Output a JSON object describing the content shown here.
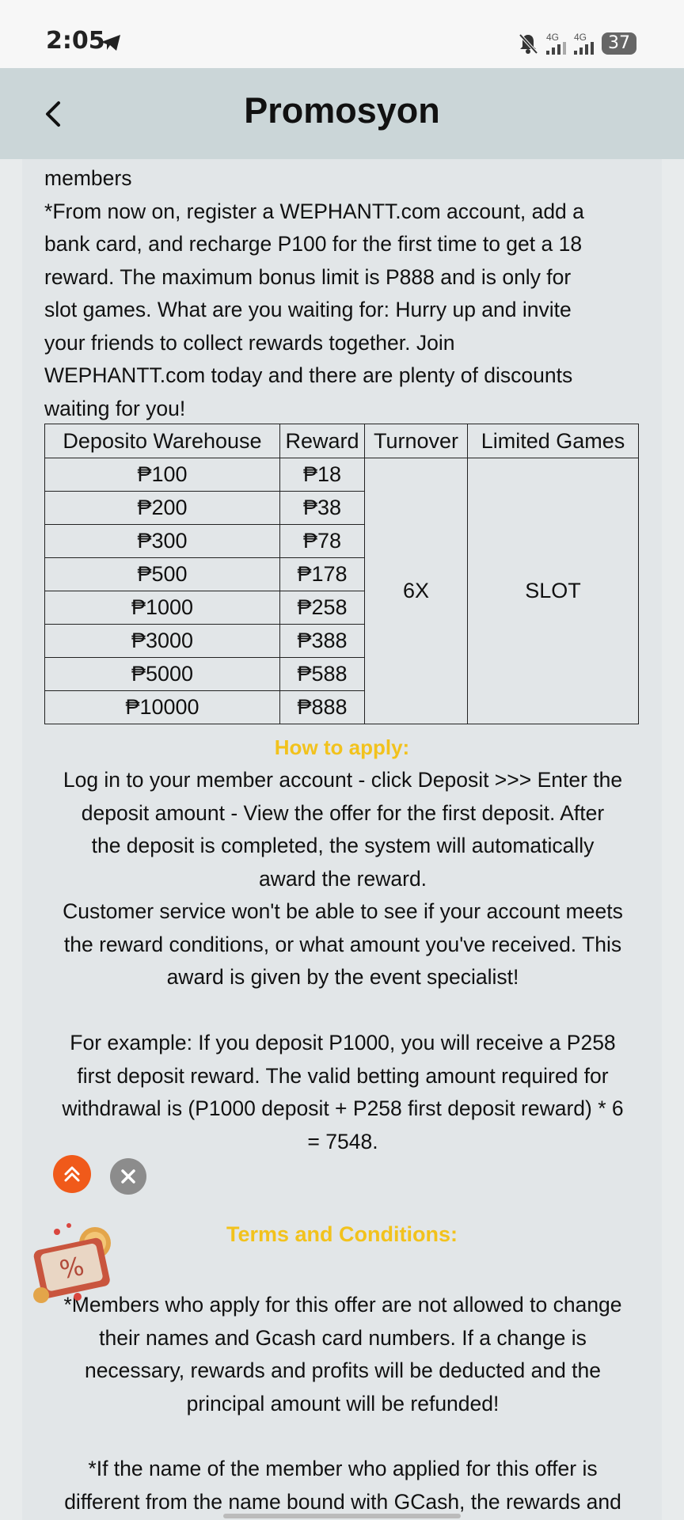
{
  "status": {
    "time": "2:05",
    "network1": "4G",
    "network2": "4G",
    "battery": "37"
  },
  "header": {
    "title": "Promosyon"
  },
  "content": {
    "intro": [
      "members",
      "*From now on, register a WEPHANTT.com account, add a",
      "bank card, and recharge P100 for the first time to get a 18",
      "reward. The maximum bonus limit is P888 and is only for",
      "slot games. What are you waiting for: Hurry up and invite",
      "your friends to collect rewards together. Join",
      "WEPHANTT.com today and there are plenty of discounts",
      "waiting for you!"
    ],
    "table": {
      "headers": [
        "Deposito Warehouse",
        "Reward",
        "Turnover",
        "Limited Games"
      ],
      "rows": [
        [
          "₱100",
          "₱18"
        ],
        [
          "₱200",
          "₱38"
        ],
        [
          "₱300",
          "₱78"
        ],
        [
          "₱500",
          "₱178"
        ],
        [
          "₱1000",
          "₱258"
        ],
        [
          "₱3000",
          "₱388"
        ],
        [
          "₱5000",
          "₱588"
        ],
        [
          "₱10000",
          "₱888"
        ]
      ],
      "turnover": "6X",
      "limited_games": "SLOT"
    },
    "how_to_apply_title": "How to apply:",
    "how_to_apply": [
      "Log in to your member account - click Deposit >>> Enter the",
      "deposit amount - View the offer for the first deposit. After",
      "the deposit is completed, the system will automatically",
      "award the reward."
    ],
    "customer_service": [
      "Customer service won't be able to see if your account meets",
      "the reward conditions, or what amount you've received. This",
      "award is given by the event specialist!"
    ],
    "example": [
      "For example: If you deposit P1000, you will receive a P258",
      "first deposit reward. The valid betting amount required for",
      "withdrawal is (P1000 deposit + P258 first deposit reward) * 6",
      "= 7548."
    ],
    "terms_title": "Terms and Conditions:",
    "terms1": [
      "*Members who apply for this offer are not allowed to change",
      "their names and Gcash card numbers. If a change is",
      "necessary, rewards and profits will be deducted and the",
      "principal amount will be refunded!"
    ],
    "terms2": [
      "*If the name of the member who applied for this offer is",
      "different from the name bound with GCash, the rewards and"
    ]
  },
  "colors": {
    "accent_title": "#f2c21c",
    "scroll_button": "#f05a1a",
    "header_bg": "#cbd6d8"
  }
}
